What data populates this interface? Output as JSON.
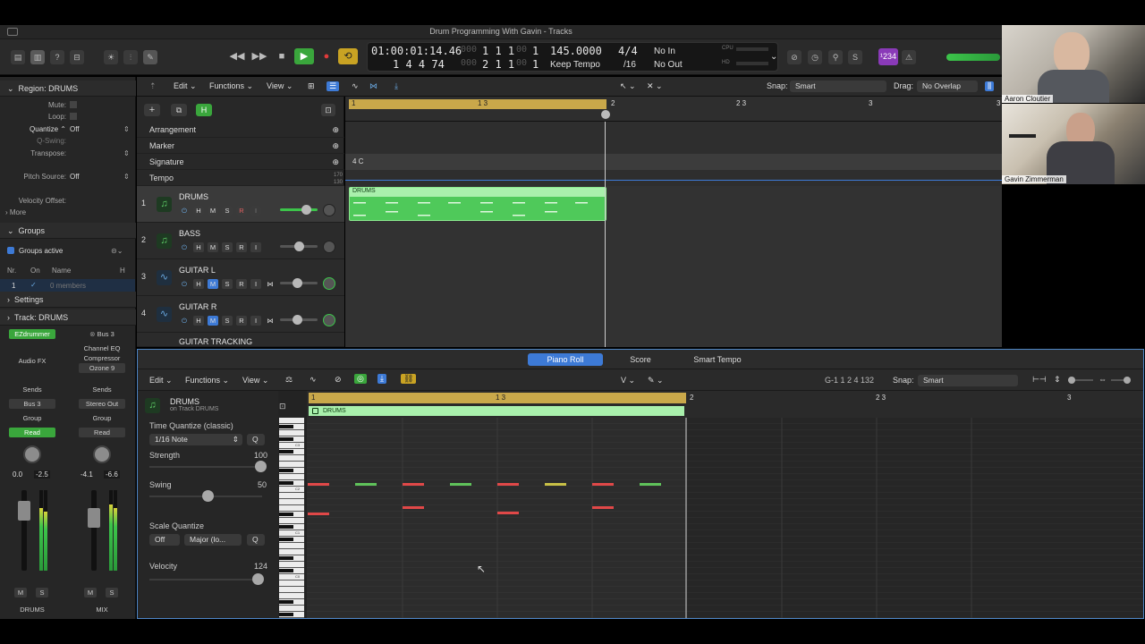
{
  "window": {
    "title": "Drum Programming With Gavin - Tracks"
  },
  "lcd": {
    "time_top": "01:00:01:14.46",
    "bars_top": "1  1  1",
    "div_top": "1",
    "tempo": "145.0000",
    "sig": "4/4",
    "in": "No In",
    "time_bottom": "1  4  4    74",
    "bars_bottom": "2  1  1",
    "div_bottom": "1",
    "tempo_mode": "Keep Tempo",
    "division": "/16",
    "out": "No Out",
    "cpu": "CPU",
    "hd": "HD",
    "counter": "¹234"
  },
  "inspector": {
    "region_label": "Region: DRUMS",
    "mute": "Mute:",
    "loop": "Loop:",
    "quantize": "Quantize",
    "quantize_val": "Off",
    "qswing": "Q-Swing:",
    "transpose": "Transpose:",
    "pitch_source": "Pitch Source:",
    "pitch_source_val": "Off",
    "velocity_offset": "Velocity Offset:",
    "more": "More",
    "groups": "Groups",
    "groups_active": "Groups active",
    "col_nr": "Nr.",
    "col_on": "On",
    "col_name": "Name",
    "col_h": "H",
    "group_nr": "1",
    "group_members": "0 members",
    "settings": "Settings",
    "track_label": "Track: DRUMS",
    "strip1": {
      "plugin": "EZdrummer",
      "audiofx": "Audio FX",
      "sends": "Sends",
      "send1": "Bus 3",
      "group": "Group",
      "auto": "Read",
      "val1": "0.0",
      "val2": "-2.5",
      "m": "M",
      "s": "S",
      "name": "DRUMS"
    },
    "strip2": {
      "input": "Bus 3",
      "fx1": "Channel EQ",
      "fx2": "Compressor",
      "fx3": "Ozone 9",
      "sends": "Sends",
      "out": "Stereo Out",
      "group": "Group",
      "auto": "Read",
      "val1": "-4.1",
      "val2": "-6.6",
      "m": "M",
      "s": "S",
      "name": "MIX"
    }
  },
  "tracks_header": {
    "edit": "Edit",
    "functions": "Functions",
    "view": "View",
    "snap_label": "Snap:",
    "snap_val": "Smart",
    "drag_label": "Drag:",
    "drag_val": "No Overlap"
  },
  "global_tracks": [
    "Arrangement",
    "Marker",
    "Signature",
    "Tempo"
  ],
  "tempo_max": "170",
  "tempo_min": "130",
  "signature_marker": "4  C",
  "ruler": [
    "1",
    "1 3",
    "2",
    "2 3",
    "3",
    "3"
  ],
  "tracks": [
    {
      "num": "1",
      "name": "DRUMS",
      "h": "H",
      "m": "M",
      "s": "S",
      "r": "R",
      "i": "I"
    },
    {
      "num": "2",
      "name": "BASS",
      "h": "H",
      "m": "M",
      "s": "S",
      "r": "R",
      "i": "I"
    },
    {
      "num": "3",
      "name": "GUITAR L",
      "h": "H",
      "m": "M",
      "s": "S",
      "r": "R",
      "i": "I"
    },
    {
      "num": "4",
      "name": "GUITAR R",
      "h": "H",
      "m": "M",
      "s": "S",
      "r": "R",
      "i": "I"
    },
    {
      "num": "",
      "name": "GUITAR TRACKING"
    }
  ],
  "region": {
    "name": "DRUMS"
  },
  "piano_roll": {
    "tabs": [
      "Piano Roll",
      "Score",
      "Smart Tempo"
    ],
    "edit": "Edit",
    "functions": "Functions",
    "view": "View",
    "position": "G-1   1 2 4 132",
    "snap_label": "Snap:",
    "snap_val": "Smart",
    "region_name": "DRUMS",
    "region_track": "on Track DRUMS",
    "time_quantize": "Time Quantize (classic)",
    "note_val": "1/16 Note",
    "q": "Q",
    "strength": "Strength",
    "strength_val": "100",
    "swing": "Swing",
    "swing_val": "50",
    "scale_quantize": "Scale Quantize",
    "scale_off": "Off",
    "scale_mode": "Major (lo...",
    "velocity": "Velocity",
    "velocity_val": "124",
    "ruler": [
      "1",
      "1 3",
      "2",
      "2 3",
      "3"
    ],
    "region_label": "DRUMS",
    "key_labels": [
      "C3",
      "C2",
      "C1",
      "C0"
    ]
  },
  "video": {
    "person1": "Aaron Cloutier",
    "person2": "Gavin Zimmerman"
  },
  "colors": {
    "region": "#4fc95a",
    "accent": "#3d7ad6",
    "ruler_gold": "#c9a84a",
    "note_red": "#e04848",
    "note_green": "#5fc25a",
    "note_yellow": "#c8c046"
  }
}
